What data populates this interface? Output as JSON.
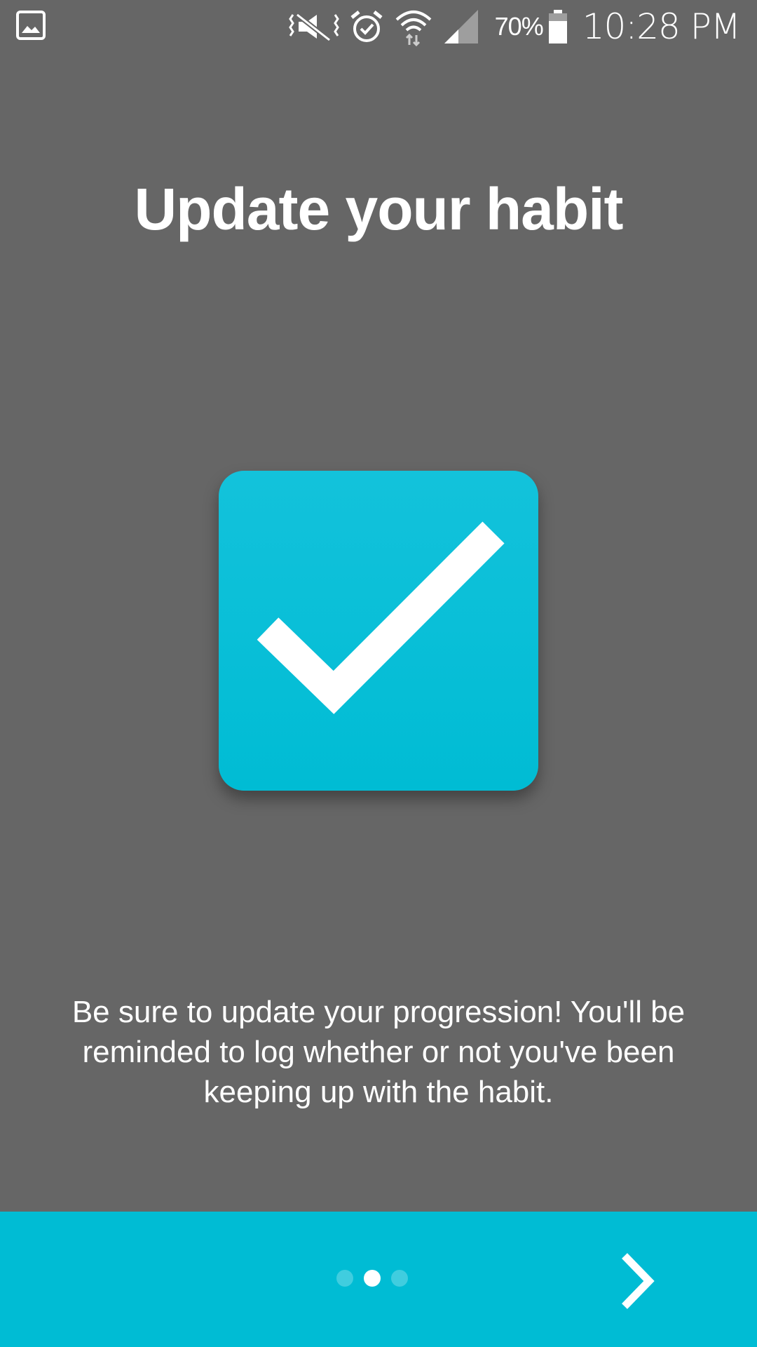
{
  "status_bar": {
    "left_icon": "gallery-icon",
    "icons": [
      "vibrate-icon",
      "alarm-icon",
      "wifi-icon",
      "signal-icon"
    ],
    "battery_percent": "70%",
    "battery_icon": "battery-icon",
    "time": "10:28 PM"
  },
  "onboarding": {
    "title": "Update your habit",
    "illustration_icon": "checkbox-checked-icon",
    "description": "Be sure to update your progression! You'll be reminded to log whether or not you've been keeping up with the habit.",
    "page_indicator": {
      "total": 3,
      "current": 2
    },
    "next_icon": "chevron-right-icon"
  },
  "colors": {
    "background": "#666666",
    "accent": "#00bcd4",
    "text": "#ffffff"
  }
}
